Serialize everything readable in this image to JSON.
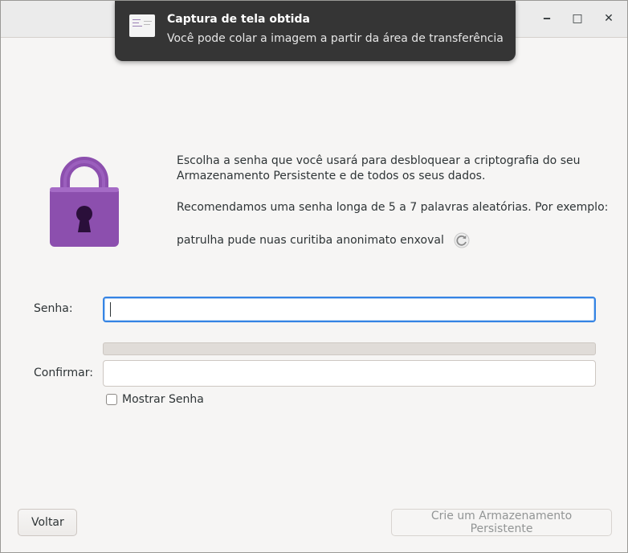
{
  "window": {
    "minimize_glyph": "‒",
    "maximize_glyph": "□",
    "close_glyph": "✕"
  },
  "notification": {
    "title": "Captura de tela obtida",
    "body": "Você pode colar a imagem a partir da área de transferência",
    "thumbnail_icon": "screenshot-thumbnail-icon"
  },
  "intro": {
    "paragraph1_line1": "Escolha a senha que você usará para desbloquear a criptografia do seu",
    "paragraph1_line2": "Armazenamento Persistente e de todos os seus dados.",
    "paragraph2": "Recomendamos uma senha longa de 5 a 7 palavras aleatórias. Por exemplo:",
    "example_passphrase": "patrulha pude nuas curitiba anonimato enxoval"
  },
  "form": {
    "password_label": "Senha:",
    "password_value": "",
    "confirm_label": "Confirmar:",
    "confirm_value": "",
    "strength_percent": 0,
    "show_password_label": "Mostrar Senha",
    "show_password_checked": false
  },
  "buttons": {
    "back_label": "Voltar",
    "create_label": "Crie um Armazenamento Persistente"
  },
  "icons": {
    "lock": "padlock-icon",
    "refresh": "refresh-icon"
  },
  "colors": {
    "lock_purple": "#8c4fae",
    "lock_dark": "#6b2f8b",
    "focus_blue": "#3584e4",
    "toast_bg": "#353535"
  }
}
